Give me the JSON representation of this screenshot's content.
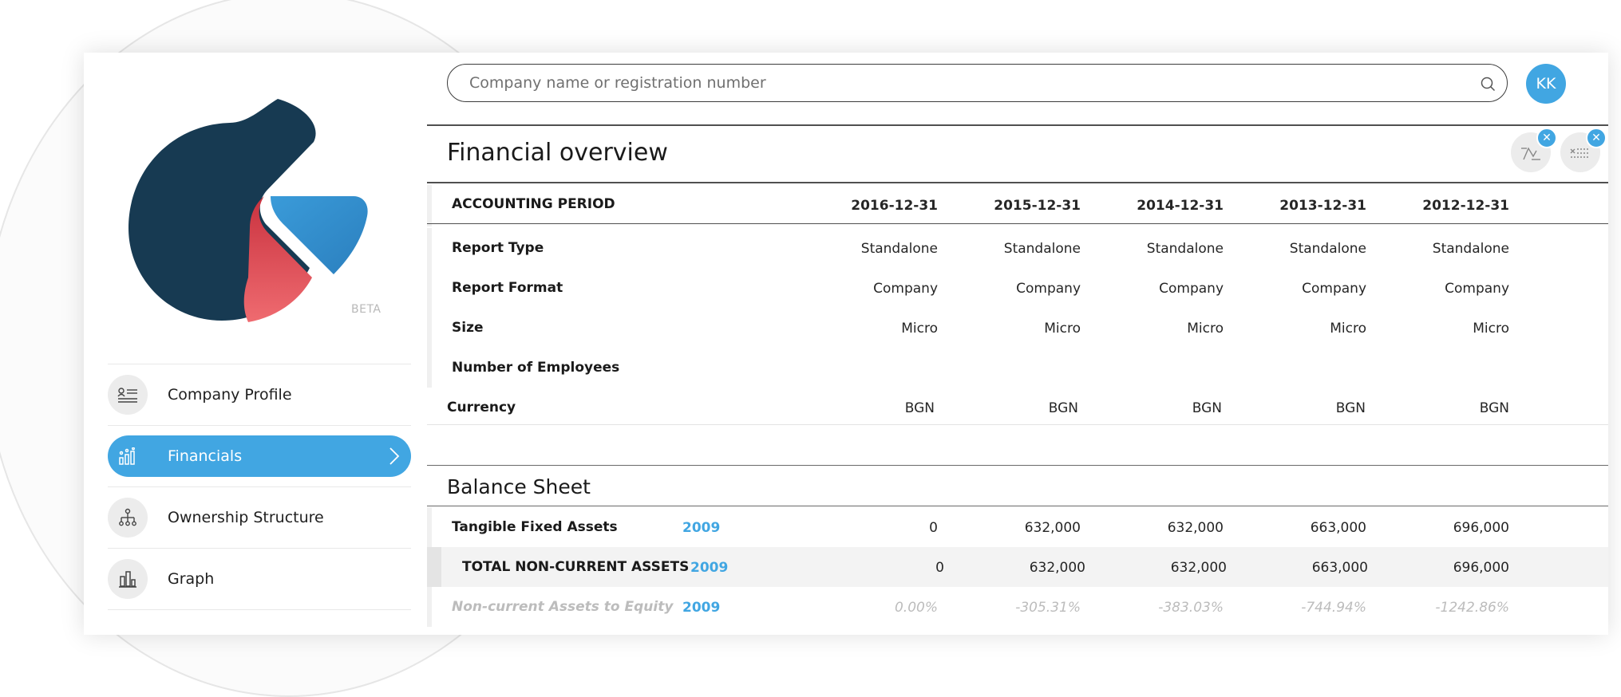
{
  "brand": {
    "badge": "BETA"
  },
  "search": {
    "placeholder": "Company name or registration number"
  },
  "user": {
    "initials": "KK"
  },
  "nav": {
    "items": [
      {
        "label": "Company Profile",
        "icon": "profile-card-icon",
        "active": false
      },
      {
        "label": "Financials",
        "icon": "bar-chart-icon",
        "active": true
      },
      {
        "label": "Ownership Structure",
        "icon": "hierarchy-icon",
        "active": false
      },
      {
        "label": "Graph",
        "icon": "graph-icon",
        "active": false
      }
    ]
  },
  "overview": {
    "title": "Financial overview",
    "period_label": "ACCOUNTING PERIOD",
    "periods": [
      "2016-12-31",
      "2015-12-31",
      "2014-12-31",
      "2013-12-31",
      "2012-12-31"
    ],
    "rows": [
      {
        "label": "Report Type",
        "values": [
          "Standalone",
          "Standalone",
          "Standalone",
          "Standalone",
          "Standalone"
        ]
      },
      {
        "label": "Report Format",
        "values": [
          "Company",
          "Company",
          "Company",
          "Company",
          "Company"
        ]
      },
      {
        "label": "Size",
        "values": [
          "Micro",
          "Micro",
          "Micro",
          "Micro",
          "Micro"
        ]
      },
      {
        "label": "Number of Employees",
        "values": [
          "",
          "",
          "",
          "",
          ""
        ]
      },
      {
        "label": "Currency",
        "values": [
          "BGN",
          "BGN",
          "BGN",
          "BGN",
          "BGN"
        ]
      }
    ]
  },
  "balance": {
    "title": "Balance Sheet",
    "rows": [
      {
        "label": "Tangible Fixed Assets",
        "year": "2009",
        "values": [
          "0",
          "632,000",
          "632,000",
          "663,000",
          "696,000"
        ]
      },
      {
        "label": "TOTAL NON-CURRENT ASSETS",
        "year": "2009",
        "values": [
          "0",
          "632,000",
          "632,000",
          "663,000",
          "696,000"
        ]
      },
      {
        "label": "Non-current Assets to Equity",
        "year": "2009",
        "values": [
          "0.00%",
          "-305.31%",
          "-383.03%",
          "-744.94%",
          "-1242.86%"
        ]
      }
    ]
  },
  "colors": {
    "accent": "#41a6e2",
    "logo_dark": "#173a52",
    "logo_red": "#e14a55",
    "logo_blue": "#41a6e2"
  }
}
